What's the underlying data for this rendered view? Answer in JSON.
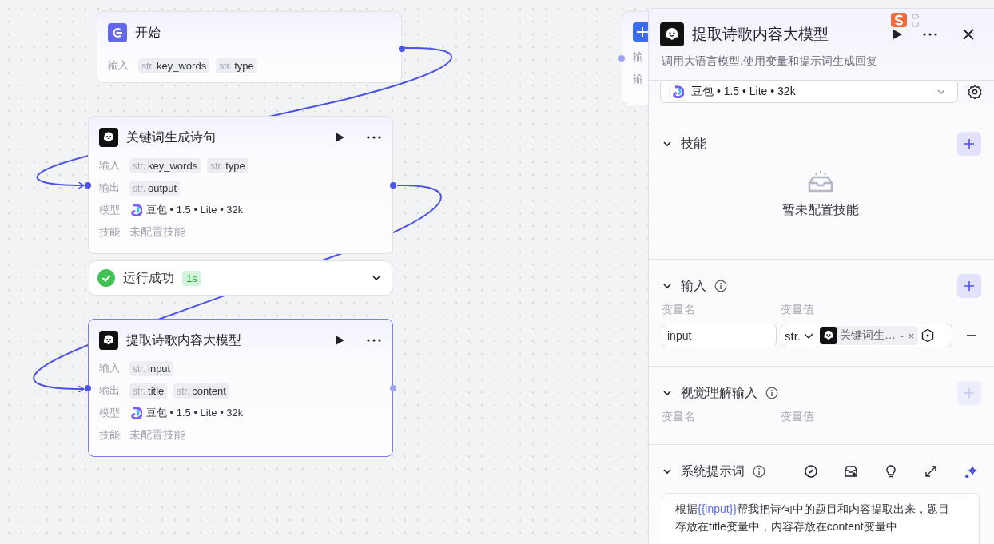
{
  "canvas": {
    "nodes": [
      {
        "kind": "start",
        "title": "开始",
        "selected": false,
        "rows": [
          {
            "kind": "tags",
            "label": "输入",
            "tags": [
              {
                "type": "str.",
                "name": "key_words"
              },
              {
                "type": "str.",
                "name": "type"
              }
            ]
          }
        ]
      },
      {
        "kind": "llm",
        "title": "关键词生成诗句",
        "selected": false,
        "rows": [
          {
            "kind": "tags",
            "label": "输入",
            "tags": [
              {
                "type": "str.",
                "name": "key_words"
              },
              {
                "type": "str.",
                "name": "type"
              }
            ]
          },
          {
            "kind": "tags",
            "label": "输出",
            "tags": [
              {
                "type": "str.",
                "name": "output"
              }
            ]
          },
          {
            "kind": "model",
            "label": "模型",
            "text": "豆包 • 1.5 • Lite • 32k"
          },
          {
            "kind": "text",
            "label": "技能",
            "text": "未配置技能"
          }
        ]
      },
      {
        "kind": "result",
        "status": "运行成功",
        "duration": "1s"
      },
      {
        "kind": "llm",
        "title": "提取诗歌内容大模型",
        "selected": true,
        "rows": [
          {
            "kind": "tags",
            "label": "输入",
            "tags": [
              {
                "type": "str.",
                "name": "input"
              }
            ]
          },
          {
            "kind": "tags",
            "label": "输出",
            "tags": [
              {
                "type": "str.",
                "name": "title"
              },
              {
                "type": "str.",
                "name": "content"
              }
            ]
          },
          {
            "kind": "model",
            "label": "模型",
            "text": "豆包 • 1.5 • Lite • 32k"
          },
          {
            "kind": "text",
            "label": "技能",
            "text": "未配置技能"
          }
        ]
      },
      {
        "kind": "partial",
        "rows": [
          "输",
          "输"
        ]
      }
    ]
  },
  "panel": {
    "title": "提取诗歌内容大模型",
    "subtitle": "调用大语言模型,使用变量和提示词生成回复",
    "model": "豆包 • 1.5 • Lite • 32k",
    "sections": [
      {
        "kind": "skills",
        "title": "技能",
        "expanded": true,
        "add_disabled": false,
        "empty_text": "暂未配置技能"
      },
      {
        "kind": "inputs",
        "title": "输入",
        "expanded": true,
        "info": true,
        "add_disabled": false,
        "columns": [
          "变量名",
          "变量值"
        ],
        "rows": [
          {
            "name": "input",
            "type": "str.",
            "ref": "关键词生…",
            "ref_sep": "-",
            "clear": "×"
          }
        ]
      },
      {
        "kind": "vision",
        "title": "视觉理解输入",
        "expanded": true,
        "info": true,
        "add_disabled": true,
        "columns": [
          "变量名",
          "变量值"
        ]
      },
      {
        "kind": "prompt",
        "title": "系统提示词",
        "expanded": true,
        "info": true,
        "prompt": [
          {
            "kind": "text",
            "text": "根据"
          },
          {
            "kind": "var",
            "text": "{{input}}"
          },
          {
            "kind": "text",
            "text": "帮我把诗句中的题目和内容提取出来，题目存放在title变量中，内容存放在content变量中"
          }
        ]
      }
    ]
  }
}
